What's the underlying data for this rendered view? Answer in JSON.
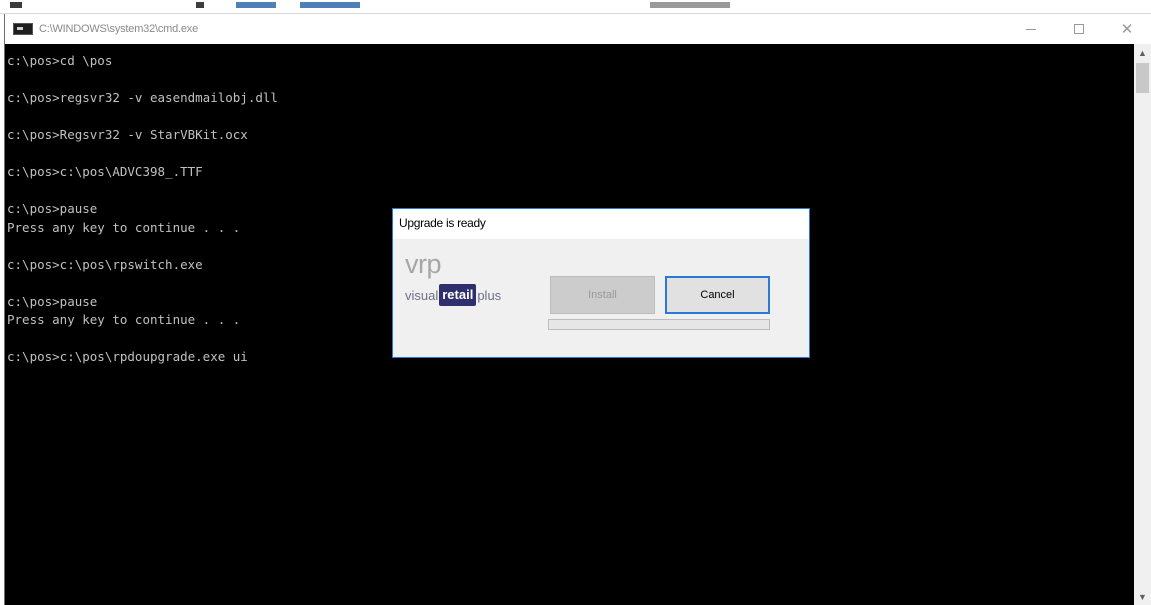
{
  "window": {
    "title": "C:\\WINDOWS\\system32\\cmd.exe",
    "controls": {
      "minimize_icon": "minimize-icon",
      "maximize_icon": "maximize-icon",
      "close_glyph": "✕"
    }
  },
  "console": {
    "lines": [
      "c:\\pos>cd \\pos",
      "",
      "c:\\pos>regsvr32 -v easendmailobj.dll",
      "",
      "c:\\pos>Regsvr32 -v StarVBKit.ocx",
      "",
      "c:\\pos>c:\\pos\\ADVC398_.TTF",
      "",
      "c:\\pos>pause",
      "Press any key to continue . . .",
      "",
      "c:\\pos>c:\\pos\\rpswitch.exe",
      "",
      "c:\\pos>pause",
      "Press any key to continue . . .",
      "",
      "c:\\pos>c:\\pos\\rpdoupgrade.exe ui"
    ],
    "text_color": "#c0c0c0",
    "background": "#000000"
  },
  "dialog": {
    "title": "Upgrade is ready",
    "logo": {
      "brand": "vrp",
      "word1": "visual",
      "word2": "retail",
      "word3": "plus"
    },
    "install_label": "Install",
    "cancel_label": "Cancel",
    "progress_percent": 0,
    "accent": "#2b79d6"
  }
}
